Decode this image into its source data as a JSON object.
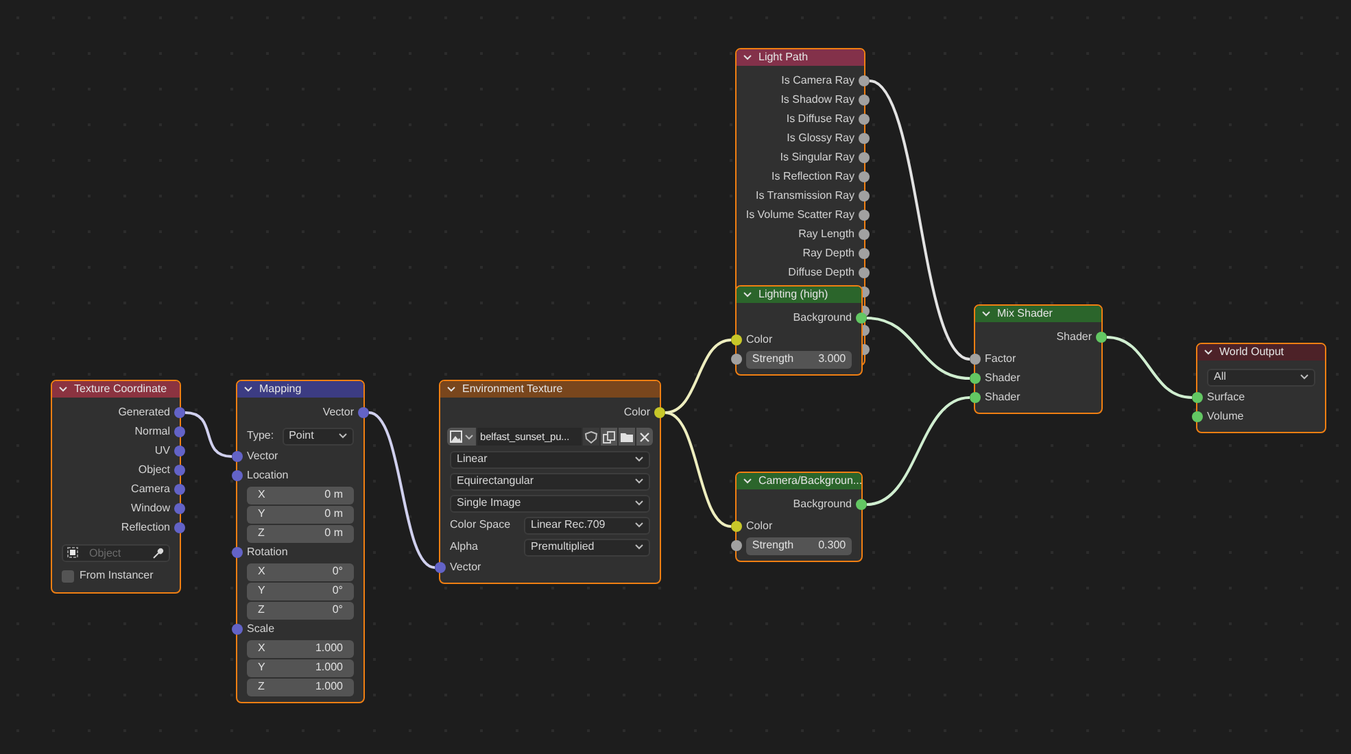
{
  "nodes": [
    {
      "title": "Texture Coordinate",
      "color": "#8b3340",
      "selected": true,
      "rows": [
        {
          "kind": "output",
          "label": "Generated",
          "color": "#6363c7"
        },
        {
          "kind": "output",
          "label": "Normal",
          "color": "#6363c7"
        },
        {
          "kind": "output",
          "label": "UV",
          "color": "#6363c7"
        },
        {
          "kind": "output",
          "label": "Object",
          "color": "#6363c7"
        },
        {
          "kind": "output",
          "label": "Camera",
          "color": "#6363c7"
        },
        {
          "kind": "output",
          "label": "Window",
          "color": "#6363c7"
        },
        {
          "kind": "output",
          "label": "Reflection",
          "color": "#6363c7"
        },
        {
          "kind": "object",
          "placeholder": "Object"
        },
        {
          "kind": "checkbox",
          "label": "From Instancer",
          "checked": false
        }
      ]
    },
    {
      "title": "Mapping",
      "color": "#3c3c83",
      "selected": true,
      "rows": [
        {
          "kind": "output",
          "label": "Vector",
          "color": "#6363c7"
        },
        {
          "kind": "prop",
          "label": "Type:",
          "value": "Point"
        },
        {
          "kind": "input",
          "label": "Vector",
          "color": "#6363c7"
        },
        {
          "kind": "input",
          "label": "Location",
          "color": "#6363c7"
        },
        {
          "kind": "field",
          "label": "X",
          "value": "0 m"
        },
        {
          "kind": "field",
          "label": "Y",
          "value": "0 m"
        },
        {
          "kind": "field",
          "label": "Z",
          "value": "0 m"
        },
        {
          "kind": "input",
          "label": "Rotation",
          "color": "#6363c7"
        },
        {
          "kind": "field",
          "label": "X",
          "value": "0°"
        },
        {
          "kind": "field",
          "label": "Y",
          "value": "0°"
        },
        {
          "kind": "field",
          "label": "Z",
          "value": "0°"
        },
        {
          "kind": "input",
          "label": "Scale",
          "color": "#6363c7"
        },
        {
          "kind": "field",
          "label": "X",
          "value": "1.000"
        },
        {
          "kind": "field",
          "label": "Y",
          "value": "1.000"
        },
        {
          "kind": "field",
          "label": "Z",
          "value": "1.000"
        }
      ]
    },
    {
      "title": "Environment Texture",
      "color": "#79461d",
      "selected": true,
      "rows": [
        {
          "kind": "output",
          "label": "Color",
          "color": "#c7c729"
        },
        {
          "kind": "image",
          "value": "belfast_sunset_pu..."
        },
        {
          "kind": "dropdown",
          "value": "Linear"
        },
        {
          "kind": "dropdown",
          "value": "Equirectangular"
        },
        {
          "kind": "dropdown",
          "value": "Single Image"
        },
        {
          "kind": "prop",
          "label": "Color Space",
          "value": "Linear Rec.709"
        },
        {
          "kind": "prop",
          "label": "Alpha",
          "value": "Premultiplied"
        },
        {
          "kind": "input",
          "label": "Vector",
          "color": "#6363c7"
        }
      ]
    },
    {
      "title": "Light Path",
      "color": "#83314a",
      "selected": true,
      "rows": [
        {
          "kind": "output",
          "label": "Is Camera Ray",
          "color": "#a1a1a1"
        },
        {
          "kind": "output",
          "label": "Is Shadow Ray",
          "color": "#a1a1a1"
        },
        {
          "kind": "output",
          "label": "Is Diffuse Ray",
          "color": "#a1a1a1"
        },
        {
          "kind": "output",
          "label": "Is Glossy Ray",
          "color": "#a1a1a1"
        },
        {
          "kind": "output",
          "label": "Is Singular Ray",
          "color": "#a1a1a1"
        },
        {
          "kind": "output",
          "label": "Is Reflection Ray",
          "color": "#a1a1a1"
        },
        {
          "kind": "output",
          "label": "Is Transmission Ray",
          "color": "#a1a1a1"
        },
        {
          "kind": "output",
          "label": "Is Volume Scatter Ray",
          "color": "#a1a1a1"
        },
        {
          "kind": "output",
          "label": "Ray Length",
          "color": "#a1a1a1"
        },
        {
          "kind": "output",
          "label": "Ray Depth",
          "color": "#a1a1a1"
        },
        {
          "kind": "output",
          "label": "Diffuse Depth",
          "color": "#a1a1a1"
        },
        {
          "kind": "covered",
          "color": "#a1a1a1"
        },
        {
          "kind": "covered",
          "color": "#a1a1a1"
        },
        {
          "kind": "covered",
          "color": "#a1a1a1"
        },
        {
          "kind": "covered",
          "color": "#a1a1a1"
        }
      ]
    },
    {
      "title": "Lighting (high)",
      "color": "#2b652b",
      "selected": true,
      "rows": [
        {
          "kind": "output",
          "label": "Background",
          "color": "#63c763"
        },
        {
          "kind": "input",
          "label": "Color",
          "color": "#c7c729"
        },
        {
          "kind": "field",
          "label": "Strength",
          "value": "3.000",
          "color": "#a1a1a1"
        }
      ]
    },
    {
      "title": "Camera/Backgroun...",
      "color": "#2b652b",
      "selected": true,
      "rows": [
        {
          "kind": "output",
          "label": "Background",
          "color": "#63c763"
        },
        {
          "kind": "input",
          "label": "Color",
          "color": "#c7c729"
        },
        {
          "kind": "field",
          "label": "Strength",
          "value": "0.300",
          "color": "#a1a1a1"
        }
      ]
    },
    {
      "title": "Mix Shader",
      "color": "#2b652b",
      "selected": true,
      "rows": [
        {
          "kind": "output",
          "label": "Shader",
          "color": "#63c763"
        },
        {
          "kind": "input",
          "label": "Factor",
          "color": "#a1a1a1"
        },
        {
          "kind": "input",
          "label": "Shader",
          "color": "#63c763"
        },
        {
          "kind": "input",
          "label": "Shader",
          "color": "#63c763"
        }
      ]
    },
    {
      "title": "World Output",
      "color": "#4d2228",
      "selected": true,
      "rows": [
        {
          "kind": "dropdown",
          "value": "All"
        },
        {
          "kind": "input",
          "label": "Surface",
          "color": "#63c763"
        },
        {
          "kind": "input",
          "label": "Volume",
          "color": "#63c763"
        }
      ]
    }
  ]
}
